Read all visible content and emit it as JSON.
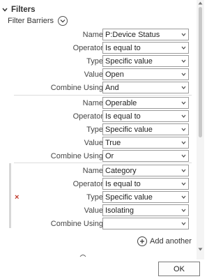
{
  "section": {
    "title": "Filters"
  },
  "barriers": {
    "label": "Filter Barriers"
  },
  "labels": {
    "name": "Name",
    "operator": "Operator",
    "type": "Type",
    "value": "Value",
    "combine": "Combine Using"
  },
  "groups": [
    {
      "name": "P:Device Status",
      "operator": "Is equal to",
      "type": "Specific value",
      "value": "Open",
      "combine": "And"
    },
    {
      "name": "Operable",
      "operator": "Is equal to",
      "type": "Specific value",
      "value": "True",
      "combine": "Or"
    },
    {
      "name": "Category",
      "operator": "Is equal to",
      "type": "Specific value",
      "value": "Isolating",
      "combine": ""
    }
  ],
  "remove_icon": "×",
  "add_another": "Add another",
  "ok": "OK",
  "colors": {
    "remove": "#c0392b",
    "border": "#9a9a9a"
  }
}
